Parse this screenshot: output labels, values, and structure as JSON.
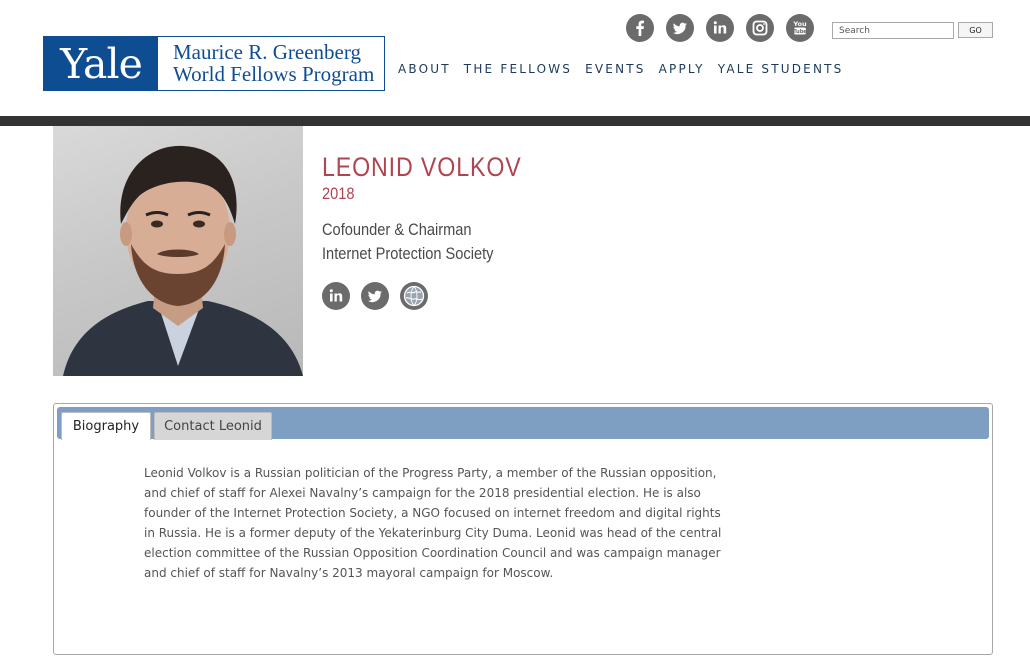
{
  "header": {
    "logo": {
      "yale": "Yale",
      "line1": "Maurice R. Greenberg",
      "line2": "World Fellows Program"
    },
    "social_icons": [
      "facebook-icon",
      "twitter-icon",
      "linkedin-icon",
      "instagram-icon",
      "youtube-icon"
    ],
    "search": {
      "placeholder": "Search",
      "button": "GO"
    },
    "nav": [
      "ABOUT",
      "THE FELLOWS",
      "EVENTS",
      "APPLY",
      "YALE STUDENTS"
    ]
  },
  "profile": {
    "name": "LEONID VOLKOV",
    "year": "2018",
    "title": "Cofounder & Chairman",
    "organization": "Internet Protection Society",
    "social_icons": [
      "linkedin-icon",
      "twitter-icon",
      "globe-icon"
    ]
  },
  "tabs": {
    "items": [
      "Biography",
      "Contact Leonid"
    ],
    "active": "Biography",
    "biography": "Leonid Volkov is a Russian politician of the Progress Party, a member of the Russian opposition, and chief of staff for Alexei Navalny’s campaign for the 2018 presidential election. He is also founder of the Internet Protection Society, a NGO focused on internet freedom and digital rights in Russia. He is a former deputy of the Yekaterinburg City Duma. Leonid was head of the central election committee of the Russian Opposition Coordination Council and was campaign manager and chief of staff for Navalny’s 2013 mayoral campaign for Moscow."
  },
  "colors": {
    "brand_blue": "#0f4d92",
    "name_red": "#b24452",
    "tab_bar": "#7f9fc2",
    "divider": "#333333",
    "icon_gray": "#6b6b6b"
  }
}
